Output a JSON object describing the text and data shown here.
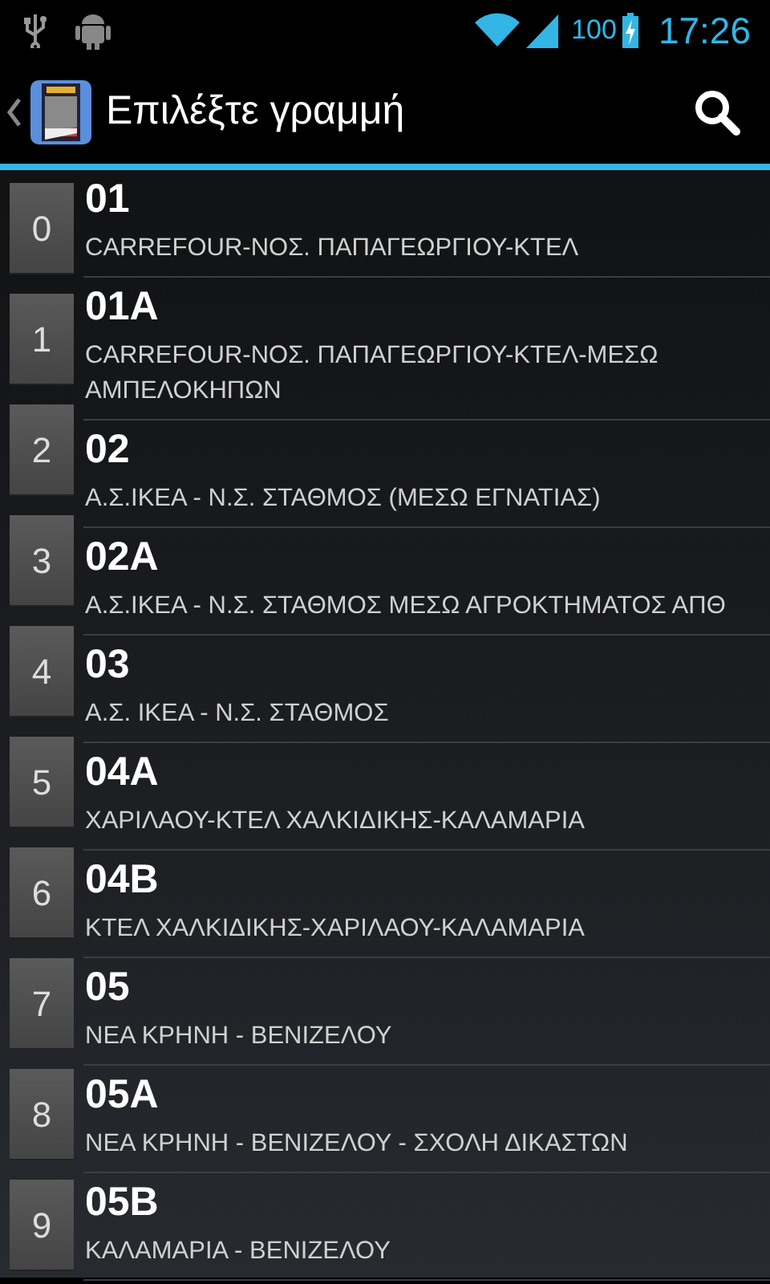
{
  "status_bar": {
    "battery_percent": "100",
    "time": "17:26"
  },
  "action_bar": {
    "title": "Επιλέξτε γραμμή"
  },
  "index_keys": [
    "0",
    "1",
    "2",
    "3",
    "4",
    "5",
    "6",
    "7",
    "8",
    "9"
  ],
  "lines": [
    {
      "number": "01",
      "route": "CARREFOUR-ΝΟΣ. ΠΑΠΑΓΕΩΡΓΙΟΥ-ΚΤΕΛ"
    },
    {
      "number": "01A",
      "route": "CARREFOUR-ΝΟΣ. ΠΑΠΑΓΕΩΡΓΙΟΥ-ΚΤΕΛ-ΜΕΣΩ ΑΜΠΕΛΟΚΗΠΩΝ"
    },
    {
      "number": "02",
      "route": "Α.Σ.ΙΚΕΑ - Ν.Σ. ΣΤΑΘΜΟΣ (ΜΕΣΩ ΕΓΝΑΤΙΑΣ)"
    },
    {
      "number": "02A",
      "route": "Α.Σ.ΙΚΕΑ - Ν.Σ. ΣΤΑΘΜΟΣ ΜΕΣΩ ΑΓΡΟΚΤΗΜΑΤΟΣ ΑΠΘ"
    },
    {
      "number": "03",
      "route": "Α.Σ. ΙΚΕΑ - Ν.Σ. ΣΤΑΘΜΟΣ"
    },
    {
      "number": "04A",
      "route": "ΧΑΡΙΛΑΟΥ-ΚΤΕΛ ΧΑΛΚΙΔΙΚΗΣ-ΚΑΛΑΜΑΡΙΑ"
    },
    {
      "number": "04B",
      "route": "ΚΤΕΛ ΧΑΛΚΙΔΙΚΗΣ-ΧΑΡΙΛΑΟΥ-ΚΑΛΑΜΑΡΙΑ"
    },
    {
      "number": "05",
      "route": "ΝΕΑ ΚΡΗΝΗ - ΒΕΝΙΖΕΛΟΥ"
    },
    {
      "number": "05A",
      "route": "ΝΕΑ ΚΡΗΝΗ - ΒΕΝΙΖΕΛΟΥ - ΣΧΟΛΗ ΔΙΚΑΣΤΩΝ"
    },
    {
      "number": "05B",
      "route": "ΚΑΛΑΜΑΡΙΑ - ΒΕΝΙΖΕΛΟΥ"
    }
  ]
}
